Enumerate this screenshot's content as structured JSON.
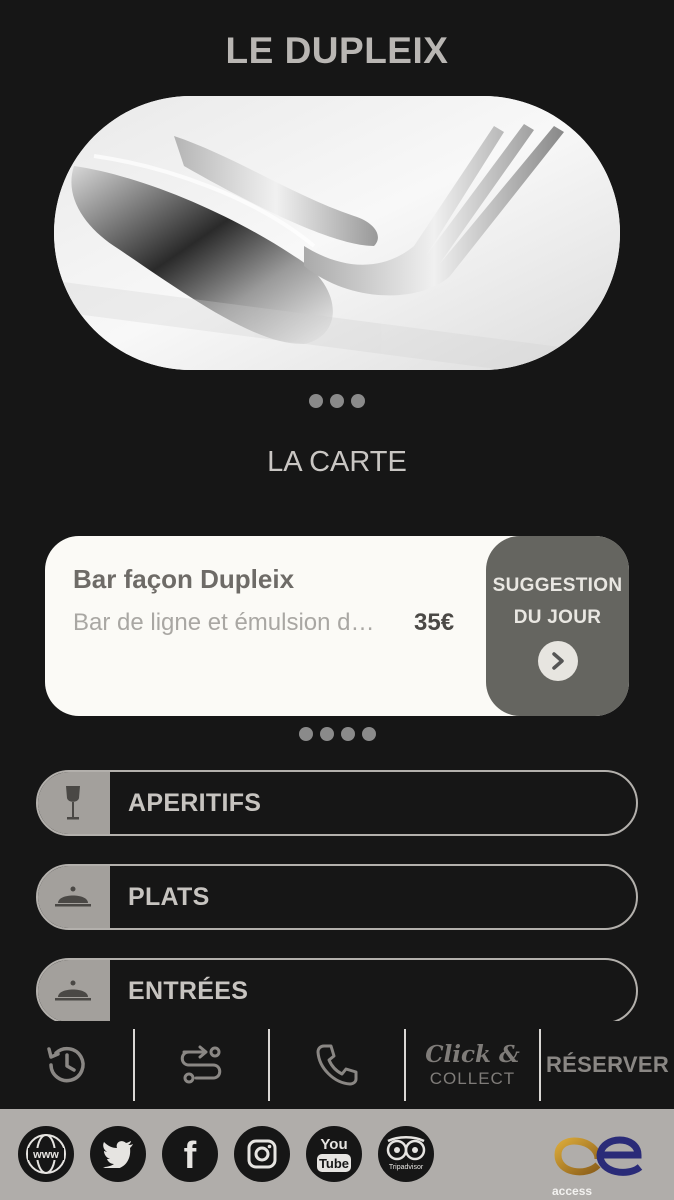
{
  "header": {
    "title": "LE DUPLEIX"
  },
  "hero": {
    "image": "cutlery-photo",
    "dots": 3
  },
  "section": {
    "title": "LA CARTE"
  },
  "suggestion": {
    "name": "Bar façon Dupleix",
    "description": "Bar de ligne et émulsion d…",
    "price": "35€",
    "side_line1": "SUGGESTION",
    "side_line2": "DU JOUR",
    "arrow_icon": "chevron-right-icon",
    "dots": 4
  },
  "menu": {
    "items": [
      {
        "label": "APERITIFS",
        "icon": "wine-glass-icon"
      },
      {
        "label": "PLATS",
        "icon": "cloche-icon"
      },
      {
        "label": "ENTRÉES",
        "icon": "cloche-icon"
      }
    ]
  },
  "bottom_nav": {
    "history_icon": "history-icon",
    "route_icon": "route-icon",
    "phone_icon": "phone-icon",
    "click_collect_line1": "Click &",
    "click_collect_line2": "COLLECT",
    "reserve_label": "RÉSERVER"
  },
  "footer": {
    "social": [
      {
        "icon": "www-icon",
        "text": "www"
      },
      {
        "icon": "twitter-icon"
      },
      {
        "icon": "facebook-icon",
        "text": "f"
      },
      {
        "icon": "instagram-icon"
      },
      {
        "icon": "youtube-icon",
        "text1": "You",
        "text2": "Tube"
      },
      {
        "icon": "tripadvisor-icon",
        "text": "Tripadvisor"
      }
    ],
    "logo": {
      "icon": "access-logo",
      "text": "access"
    }
  },
  "colors": {
    "background": "#161616",
    "card": "#fbfaf6",
    "accent": "#656560",
    "footer": "#b0adaa"
  }
}
